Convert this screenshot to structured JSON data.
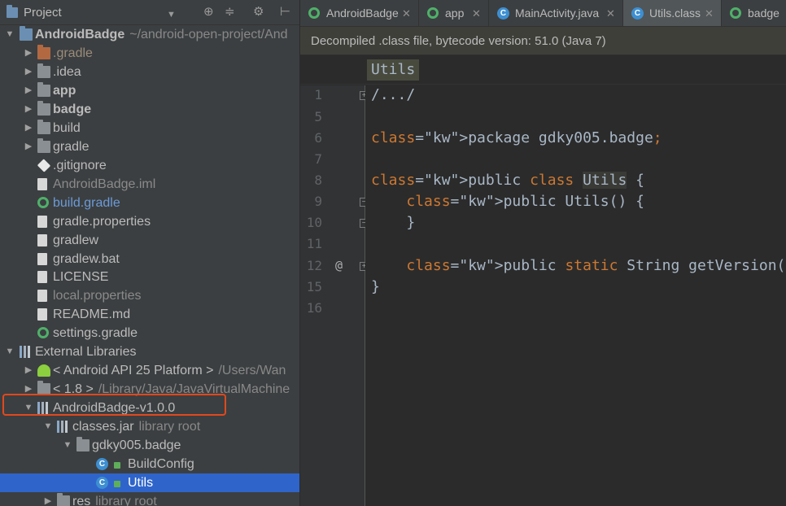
{
  "project_panel": {
    "title": "Project",
    "header_buttons": [
      "⊕",
      "≑",
      "⚙",
      "⊢"
    ],
    "tree": [
      {
        "label": "AndroidBadge",
        "sub": "~/android-open-project/And",
        "icon": "project-icon",
        "arrow": "▼",
        "style": "bold",
        "indent": 0
      },
      {
        "label": ".gradle",
        "icon": "folder-icon-orange",
        "arrow": "▶",
        "style": "orange-dim",
        "indent": 1
      },
      {
        "label": ".idea",
        "icon": "folder-icon",
        "arrow": "▶",
        "style": "normal",
        "indent": 1
      },
      {
        "label": "app",
        "icon": "module-folder-icon",
        "arrow": "▶",
        "style": "bold",
        "indent": 1
      },
      {
        "label": "badge",
        "icon": "module-folder-icon",
        "arrow": "▶",
        "style": "bold",
        "indent": 1
      },
      {
        "label": "build",
        "icon": "folder-icon",
        "arrow": "▶",
        "style": "normal",
        "indent": 1
      },
      {
        "label": "gradle",
        "icon": "folder-icon",
        "arrow": "▶",
        "style": "normal",
        "indent": 1
      },
      {
        "label": ".gitignore",
        "icon": "git-icon",
        "arrow": "",
        "style": "normal",
        "indent": 1
      },
      {
        "label": "AndroidBadge.iml",
        "icon": "iml-file-icon",
        "arrow": "",
        "style": "dim",
        "indent": 1
      },
      {
        "label": "build.gradle",
        "icon": "gradle-icon",
        "arrow": "",
        "style": "blue",
        "indent": 1
      },
      {
        "label": "gradle.properties",
        "icon": "properties-file-icon",
        "arrow": "",
        "style": "normal",
        "indent": 1
      },
      {
        "label": "gradlew",
        "icon": "text-file-icon",
        "arrow": "",
        "style": "normal",
        "indent": 1
      },
      {
        "label": "gradlew.bat",
        "icon": "bat-file-icon",
        "arrow": "",
        "style": "normal",
        "indent": 1
      },
      {
        "label": "LICENSE",
        "icon": "text-file-icon",
        "arrow": "",
        "style": "normal",
        "indent": 1
      },
      {
        "label": "local.properties",
        "icon": "properties-file-icon",
        "arrow": "",
        "style": "dim",
        "indent": 1
      },
      {
        "label": "README.md",
        "icon": "markdown-file-icon",
        "arrow": "",
        "style": "normal",
        "indent": 1
      },
      {
        "label": "settings.gradle",
        "icon": "gradle-icon",
        "arrow": "",
        "style": "normal",
        "indent": 1
      },
      {
        "label": "External Libraries",
        "icon": "libraries-icon",
        "arrow": "▼",
        "style": "normal",
        "indent": 0
      },
      {
        "label": "< Android API 25 Platform >",
        "sub": "/Users/Wan",
        "icon": "android-icon",
        "arrow": "▶",
        "style": "normal",
        "indent": 1
      },
      {
        "label": "< 1.8 >",
        "sub": "/Library/Java/JavaVirtualMachine",
        "icon": "jdk-folder-icon",
        "arrow": "▶",
        "style": "normal",
        "indent": 1
      },
      {
        "label": "AndroidBadge-v1.0.0",
        "icon": "library-icon",
        "arrow": "▼",
        "style": "normal",
        "indent": 1
      },
      {
        "label": "classes.jar",
        "sub": "library root",
        "icon": "jar-icon",
        "arrow": "▼",
        "style": "normal",
        "indent": 2
      },
      {
        "label": "gdky005.badge",
        "icon": "package-icon",
        "arrow": "▼",
        "style": "normal",
        "indent": 3
      },
      {
        "label": "BuildConfig",
        "icon": "class-icon",
        "arrow": "",
        "style": "normal",
        "indent": 4
      },
      {
        "label": "Utils",
        "icon": "class-icon",
        "arrow": "",
        "style": "normal",
        "indent": 4,
        "selected": true
      },
      {
        "label": "res",
        "sub": "library root",
        "icon": "res-folder-icon",
        "arrow": "▶",
        "style": "normal",
        "indent": 2
      }
    ]
  },
  "tabs": [
    {
      "label": "AndroidBadge",
      "icon": "gradle-icon",
      "active": false
    },
    {
      "label": "app",
      "icon": "gradle-icon",
      "active": false
    },
    {
      "label": "MainActivity.java",
      "icon": "class-icon",
      "active": false
    },
    {
      "label": "Utils.class",
      "icon": "class-icon",
      "active": true
    },
    {
      "label": "badge",
      "icon": "gradle-icon",
      "active": false
    }
  ],
  "editor": {
    "banner": "Decompiled .class file, bytecode version: 51.0 (Java 7)",
    "breadcrumb": "Utils",
    "lines": [
      {
        "num": "1",
        "code": "/.../"
      },
      {
        "num": "5",
        "code": ""
      },
      {
        "num": "6",
        "code": "package gdky005.badge;"
      },
      {
        "num": "7",
        "code": ""
      },
      {
        "num": "8",
        "code": "public class Utils {"
      },
      {
        "num": "9",
        "code": "    public Utils() {"
      },
      {
        "num": "10",
        "code": "    }"
      },
      {
        "num": "11",
        "code": ""
      },
      {
        "num": "12",
        "code": "    public static String getVersion() { return \""
      },
      {
        "num": "15",
        "code": "}"
      },
      {
        "num": "16",
        "code": ""
      }
    ],
    "gutter_override_mark": "@"
  },
  "colors": {
    "panel_bg": "#3c3f41",
    "editor_bg": "#2b2b2b",
    "selection": "#2f65ca",
    "keyword": "#cc7832",
    "highlight_box": "#e0491e"
  }
}
